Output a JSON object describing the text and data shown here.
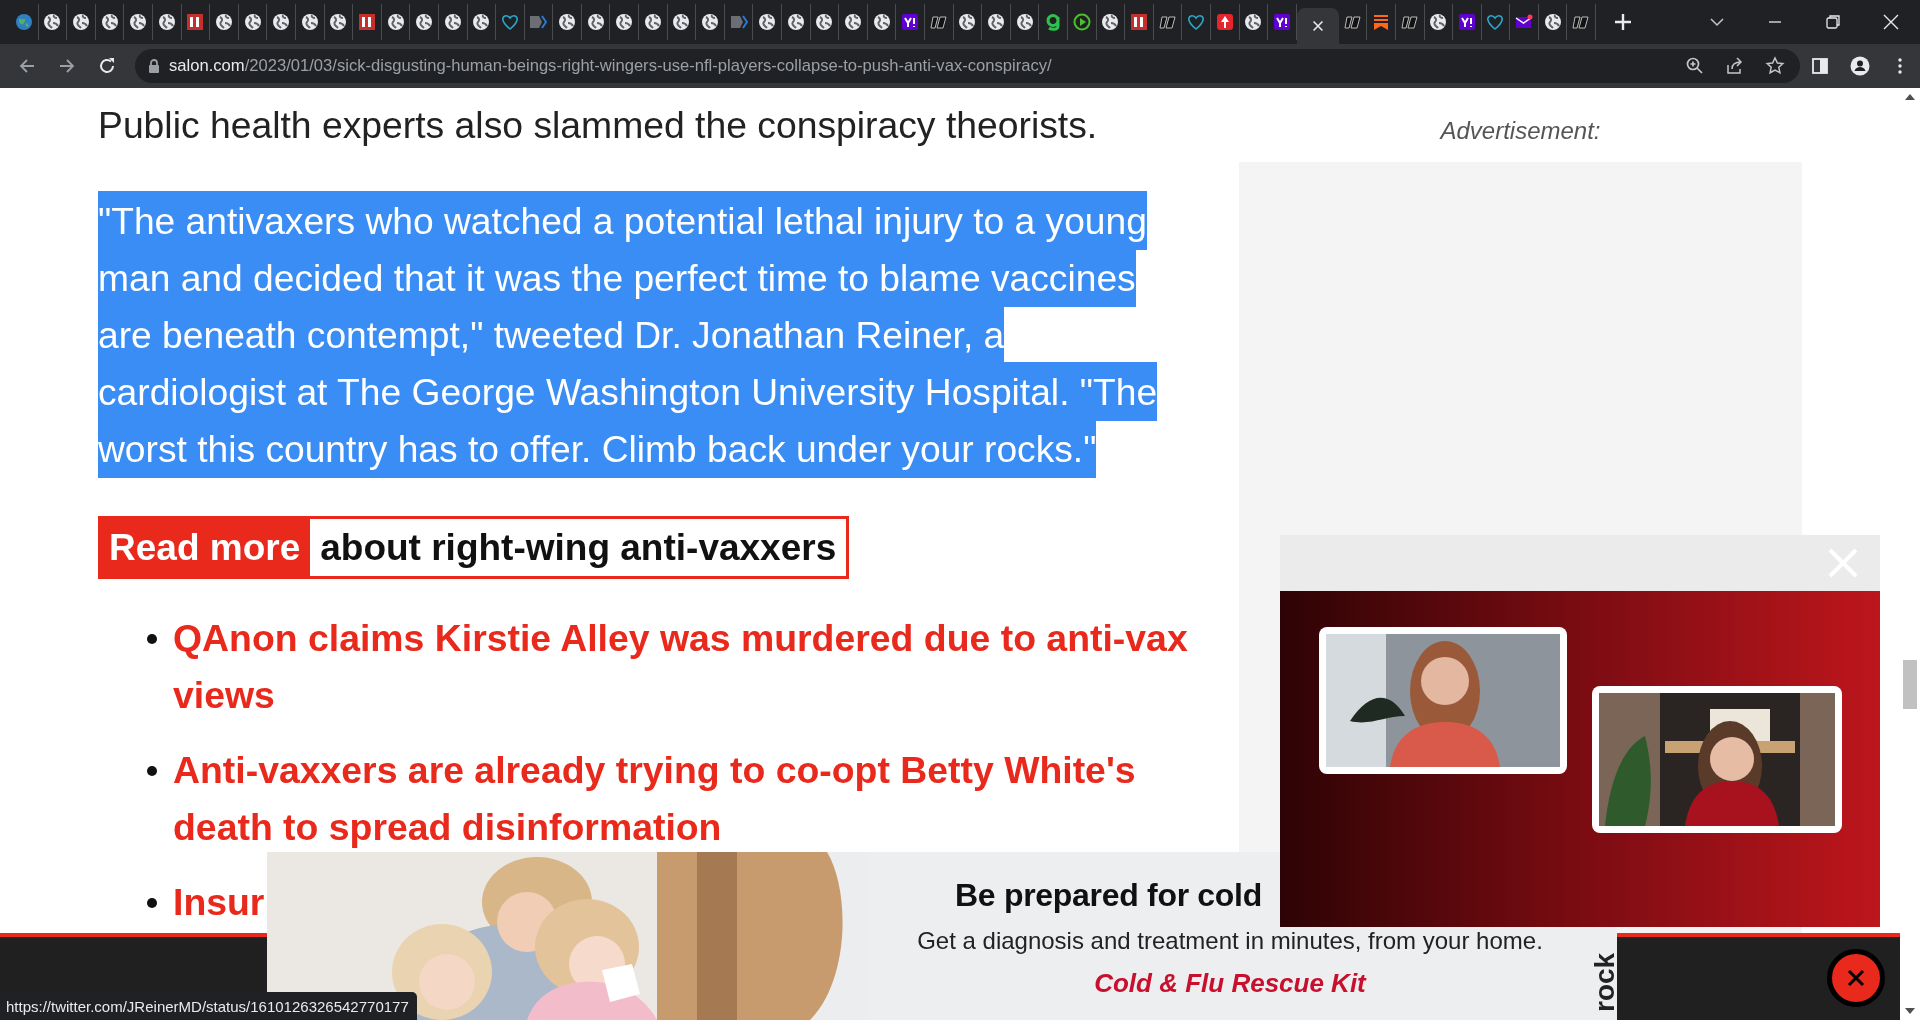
{
  "browser": {
    "tabs": [
      {
        "kind": "earth",
        "selected": false
      },
      {
        "kind": "globe",
        "selected": false
      },
      {
        "kind": "globe",
        "selected": false
      },
      {
        "kind": "globe",
        "selected": false
      },
      {
        "kind": "globe",
        "selected": false
      },
      {
        "kind": "globe",
        "selected": false
      },
      {
        "kind": "bi",
        "selected": false
      },
      {
        "kind": "globe",
        "selected": false
      },
      {
        "kind": "globe",
        "selected": false
      },
      {
        "kind": "globe",
        "selected": false
      },
      {
        "kind": "globe",
        "selected": false
      },
      {
        "kind": "globe",
        "selected": false
      },
      {
        "kind": "bi",
        "selected": false
      },
      {
        "kind": "globe",
        "selected": false
      },
      {
        "kind": "globe",
        "selected": false
      },
      {
        "kind": "globe",
        "selected": false
      },
      {
        "kind": "globe",
        "selected": false
      },
      {
        "kind": "heart",
        "selected": false
      },
      {
        "kind": "tag",
        "selected": false
      },
      {
        "kind": "globe",
        "selected": false
      },
      {
        "kind": "globe",
        "selected": false
      },
      {
        "kind": "globe",
        "selected": false
      },
      {
        "kind": "globe",
        "selected": false
      },
      {
        "kind": "globe",
        "selected": false
      },
      {
        "kind": "globe",
        "selected": false
      },
      {
        "kind": "tag",
        "selected": false
      },
      {
        "kind": "globe",
        "selected": false
      },
      {
        "kind": "globe",
        "selected": false
      },
      {
        "kind": "globe",
        "selected": false
      },
      {
        "kind": "globe",
        "selected": false
      },
      {
        "kind": "globe",
        "selected": false
      },
      {
        "kind": "yahoo",
        "selected": false
      },
      {
        "kind": "dr",
        "selected": false
      },
      {
        "kind": "globe",
        "selected": false
      },
      {
        "kind": "globe",
        "selected": false
      },
      {
        "kind": "globe",
        "selected": false
      },
      {
        "kind": "g",
        "selected": false
      },
      {
        "kind": "play",
        "selected": false
      },
      {
        "kind": "globe",
        "selected": false
      },
      {
        "kind": "bi",
        "selected": false
      },
      {
        "kind": "dr",
        "selected": false
      },
      {
        "kind": "heart",
        "selected": false
      },
      {
        "kind": "alert",
        "selected": false
      },
      {
        "kind": "globe",
        "selected": false
      },
      {
        "kind": "yahoo",
        "selected": false
      },
      {
        "kind": "active",
        "selected": true
      },
      {
        "kind": "dr",
        "selected": false
      },
      {
        "kind": "bookmark",
        "selected": false
      },
      {
        "kind": "dr",
        "selected": false
      },
      {
        "kind": "globe",
        "selected": false
      },
      {
        "kind": "yahoo",
        "selected": false
      },
      {
        "kind": "heart",
        "selected": false
      },
      {
        "kind": "mail",
        "selected": false
      },
      {
        "kind": "globe",
        "selected": false
      },
      {
        "kind": "dr",
        "selected": false
      }
    ],
    "address_bar": {
      "domain": "salon.com",
      "path": "/2023/01/03/sick-disgusting-human-beings-right-wingers-use-nfl-players-collapse-to-push-anti-vax-conspiracy/"
    }
  },
  "article": {
    "paragraph": "Public health experts also slammed the conspiracy theorists.",
    "quote": {
      "text": "\"The antivaxers who watched a potential lethal injury to a young man and decided that it was the perfect time to blame vaccines are beneath contempt,\" tweeted Dr. Jonathan Reiner, a cardiologist at The George Washington University Hospital. \"The worst this country has to offer. Climb back under your rocks.\"",
      "selected": true
    },
    "read_more": {
      "label": "Read more",
      "topic": "about right-wing anti-vaxxers"
    },
    "links": [
      {
        "lines": [
          "QAnon claims Kirstie Alley was murdered due to anti-vax",
          "views"
        ]
      },
      {
        "lines": [
          "Anti-vaxxers are already trying to co-opt Betty White's",
          "death to spread disinformation"
        ]
      },
      {
        "lines": [
          "Insur"
        ]
      }
    ]
  },
  "sidebar": {
    "ad_label": "Advertisement:"
  },
  "banner_ad": {
    "headline": "Be prepared for cold",
    "body": "Get a diagnosis and treatment in minutes, from your home.",
    "cta": "Cold & Flu Rescue Kit",
    "brand": "rock"
  },
  "status_bar": {
    "url": "https://twitter.com/JReinerMD/status/1610126326542770177"
  }
}
